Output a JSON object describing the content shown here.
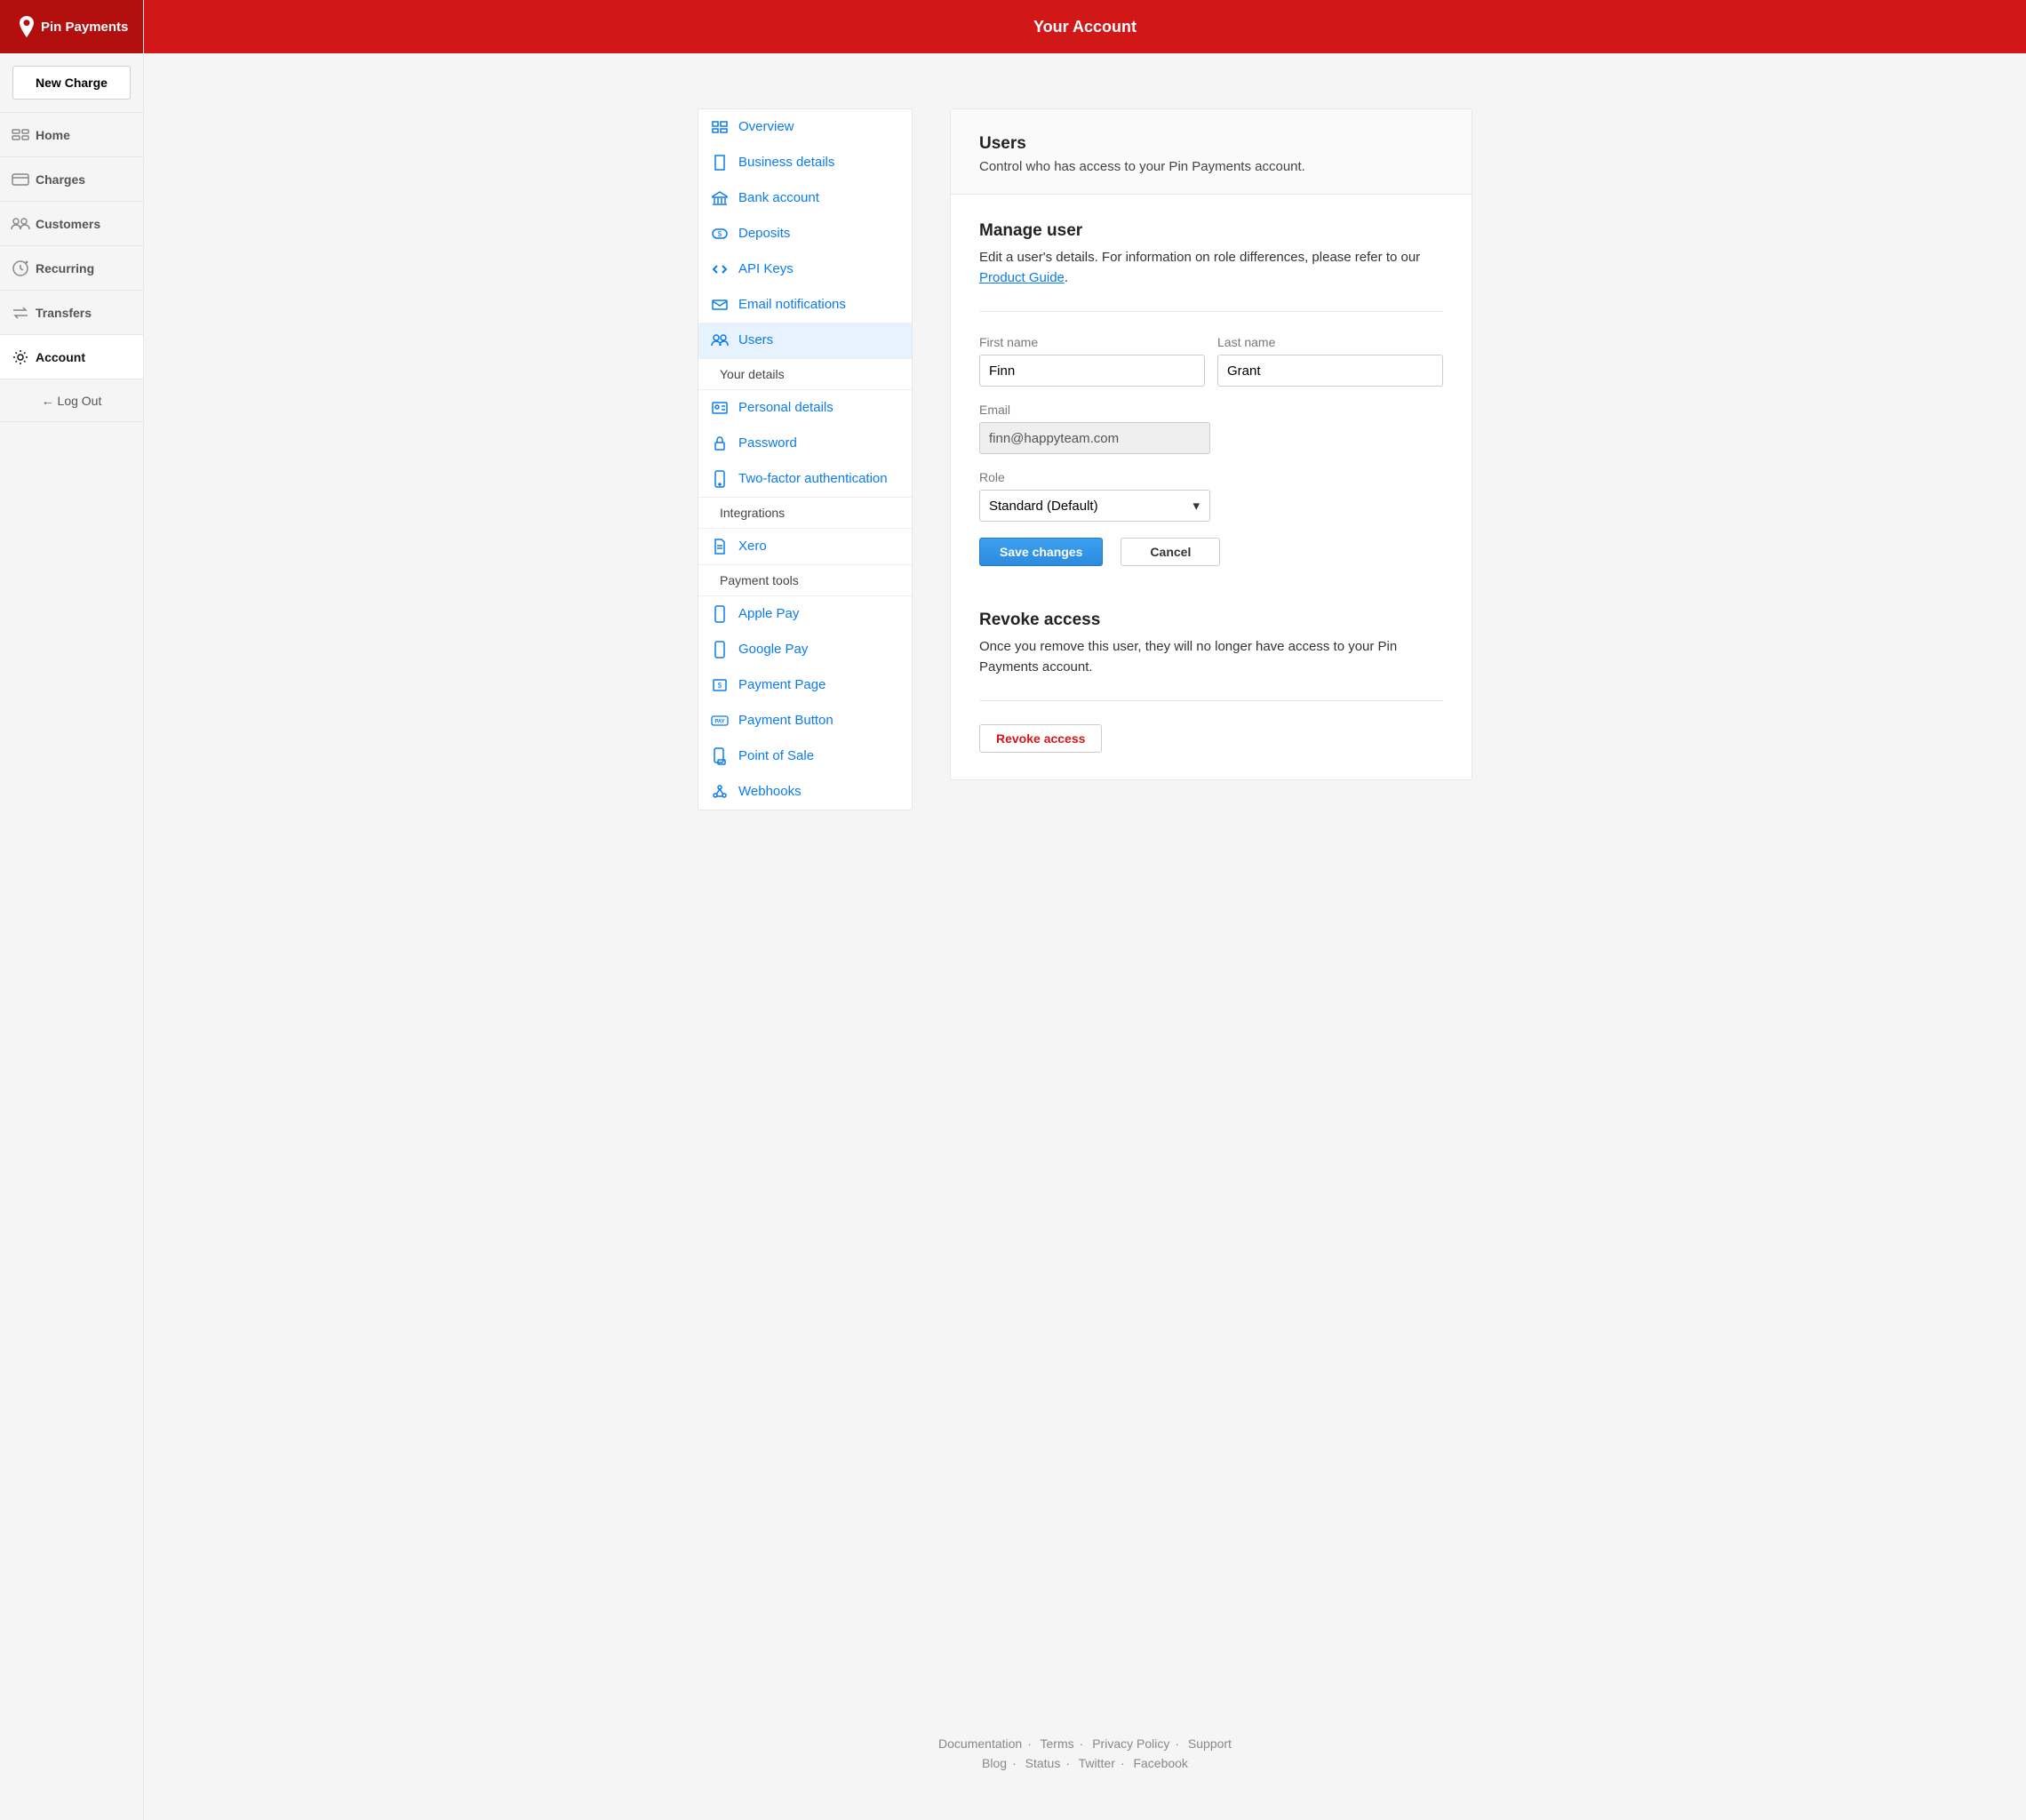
{
  "brand": "Pin Payments",
  "new_charge": "New Charge",
  "nav": {
    "home": "Home",
    "charges": "Charges",
    "customers": "Customers",
    "recurring": "Recurring",
    "transfers": "Transfers",
    "account": "Account"
  },
  "logout": "← Log Out",
  "topbar_title": "Your Account",
  "subnav": {
    "overview": "Overview",
    "business": "Business details",
    "bank": "Bank account",
    "deposits": "Deposits",
    "api": "API Keys",
    "email": "Email notifications",
    "users": "Users",
    "your_details_hdr": "Your details",
    "personal": "Personal details",
    "password": "Password",
    "twofa": "Two-factor authentication",
    "integrations_hdr": "Integrations",
    "xero": "Xero",
    "payment_tools_hdr": "Payment tools",
    "apple": "Apple Pay",
    "google": "Google Pay",
    "paypage": "Payment Page",
    "paybutton": "Payment Button",
    "pos": "Point of Sale",
    "webhooks": "Webhooks"
  },
  "panel": {
    "title": "Users",
    "subtitle": "Control who has access to your Pin Payments account."
  },
  "manage": {
    "title": "Manage user",
    "desc_pre": "Edit a user's details. For information on role differences, please refer to our ",
    "desc_link": "Product Guide",
    "desc_post": ".",
    "first_label": "First name",
    "first_value": "Finn",
    "last_label": "Last name",
    "last_value": "Grant",
    "email_label": "Email",
    "email_value": "finn@happyteam.com",
    "role_label": "Role",
    "role_value": "Standard (Default)",
    "save": "Save changes",
    "cancel": "Cancel"
  },
  "revoke": {
    "title": "Revoke access",
    "desc": "Once you remove this user, they will no longer have access to your Pin Payments account.",
    "button": "Revoke access"
  },
  "footer": {
    "docs": "Documentation",
    "terms": "Terms",
    "privacy": "Privacy Policy",
    "support": "Support",
    "blog": "Blog",
    "status": "Status",
    "twitter": "Twitter",
    "facebook": "Facebook"
  }
}
